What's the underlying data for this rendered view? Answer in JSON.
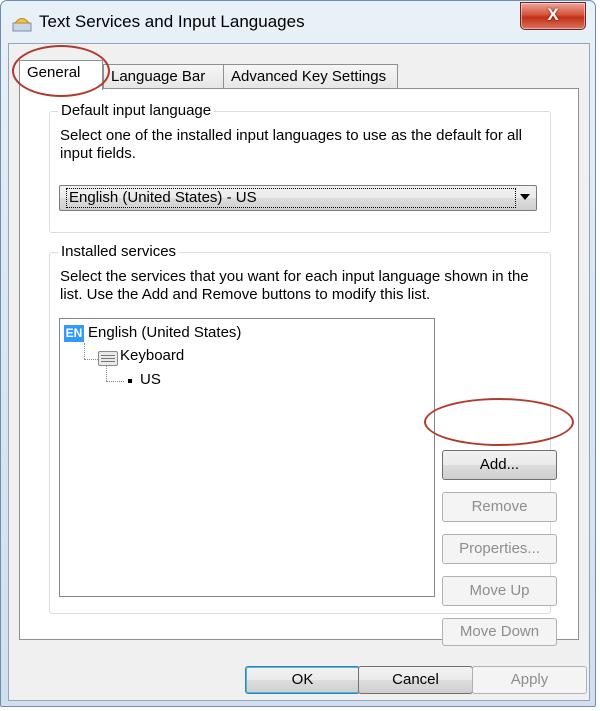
{
  "window": {
    "title": "Text Services and Input Languages",
    "close_label": "X"
  },
  "tabs": [
    {
      "label": "General",
      "active": true
    },
    {
      "label": "Language Bar",
      "active": false
    },
    {
      "label": "Advanced Key Settings",
      "active": false
    }
  ],
  "default_input": {
    "group_label": "Default input language",
    "description": "Select one of the installed input languages to use as the default for all input fields.",
    "selected": "English (United States) - US"
  },
  "installed_services": {
    "group_label": "Installed services",
    "description": "Select the services that you want for each input language shown in the list. Use the Add and Remove buttons to modify this list.",
    "tree": {
      "language_code": "EN",
      "language": "English (United States)",
      "category": "Keyboard",
      "layout": "US"
    },
    "buttons": {
      "add": "Add...",
      "remove": "Remove",
      "properties": "Properties...",
      "move_up": "Move Up",
      "move_down": "Move Down"
    }
  },
  "footer": {
    "ok": "OK",
    "cancel": "Cancel",
    "apply": "Apply"
  },
  "colors": {
    "selection_blue": "#3399ff",
    "annotation_red": "#b03a2e",
    "close_button_red": "#c22f16"
  },
  "icons": [
    "keyboard-icon",
    "app-icon",
    "close-icon"
  ]
}
